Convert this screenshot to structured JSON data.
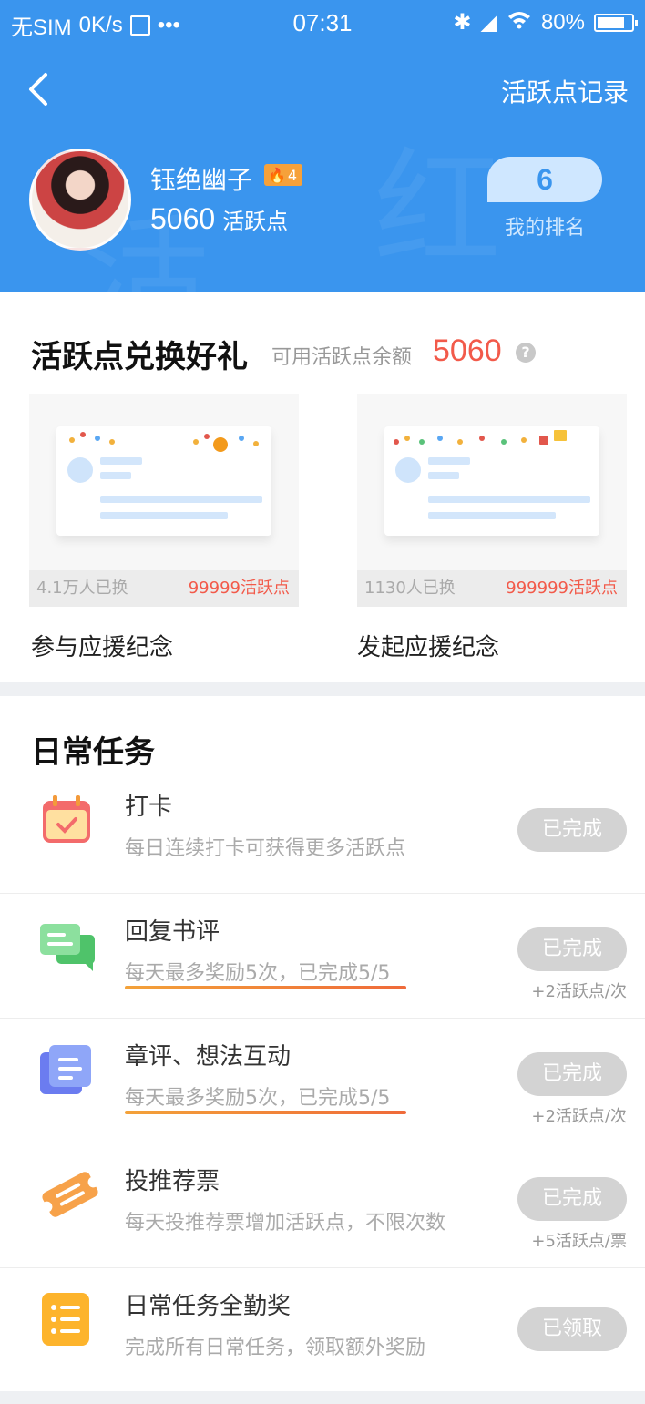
{
  "status_bar": {
    "carrier": "无SIM",
    "speed": "0K/s",
    "time": "07:31",
    "battery": "80%",
    "battery_level": 0.8
  },
  "header": {
    "record_link": "活跃点记录",
    "username": "钰绝幽子",
    "level": "4",
    "points": "5060",
    "points_unit": "活跃点",
    "rank": "6",
    "rank_label": "我的排名"
  },
  "exchange": {
    "title": "活跃点兑换好礼",
    "balance_label": "可用活跃点余额",
    "balance": "5060",
    "gifts": [
      {
        "exchanged": "4.1万人已换",
        "cost": "99999活跃点",
        "name": "参与应援纪念"
      },
      {
        "exchanged": "1130人已换",
        "cost": "999999活跃点",
        "name": "发起应援纪念"
      }
    ]
  },
  "daily": {
    "title": "日常任务",
    "tasks": [
      {
        "icon": "calendar-check-icon",
        "name": "打卡",
        "desc": "每日连续打卡可获得更多活跃点",
        "button": "已完成",
        "reward": ""
      },
      {
        "icon": "chat-bubbles-icon",
        "name": "回复书评",
        "desc": "每天最多奖励5次，已完成5/5",
        "button": "已完成",
        "reward": "+2活跃点/次"
      },
      {
        "icon": "stacked-cards-icon",
        "name": "章评、想法互动",
        "desc": "每天最多奖励5次，已完成5/5",
        "button": "已完成",
        "reward": "+2活跃点/次"
      },
      {
        "icon": "ticket-icon",
        "name": "投推荐票",
        "desc": "每天投推荐票增加活跃点，不限次数",
        "button": "已完成",
        "reward": "+5活跃点/票"
      },
      {
        "icon": "list-icon",
        "name": "日常任务全勤奖",
        "desc": "完成所有日常任务，领取额外奖励",
        "button": "已领取",
        "reward": ""
      }
    ]
  },
  "colors": {
    "header_blue": "#3a95ee",
    "accent_red": "#f25a4a",
    "button_grey": "#d3d3d3"
  }
}
